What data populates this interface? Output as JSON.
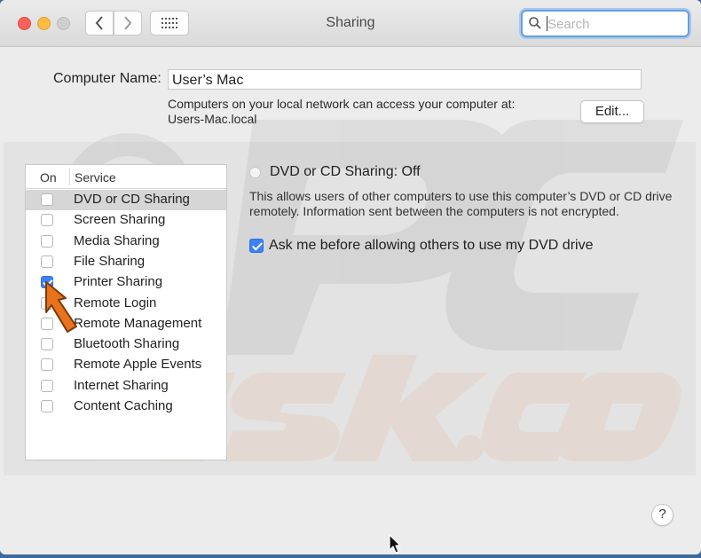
{
  "window": {
    "title": "Sharing",
    "search_placeholder": "Search"
  },
  "computer": {
    "name_label": "Computer Name:",
    "name_value": "User’s Mac",
    "access_line1": "Computers on your local network can access your computer at:",
    "access_line2": "Users-Mac.local",
    "edit_label": "Edit..."
  },
  "services": {
    "header_on": "On",
    "header_service": "Service",
    "items": [
      {
        "label": "DVD or CD Sharing",
        "checked": false,
        "selected": true
      },
      {
        "label": "Screen Sharing",
        "checked": false,
        "selected": false
      },
      {
        "label": "Media Sharing",
        "checked": false,
        "selected": false
      },
      {
        "label": "File Sharing",
        "checked": false,
        "selected": false
      },
      {
        "label": "Printer Sharing",
        "checked": true,
        "selected": false
      },
      {
        "label": "Remote Login",
        "checked": false,
        "selected": false
      },
      {
        "label": "Remote Management",
        "checked": false,
        "selected": false
      },
      {
        "label": "Bluetooth Sharing",
        "checked": false,
        "selected": false
      },
      {
        "label": "Remote Apple Events",
        "checked": false,
        "selected": false
      },
      {
        "label": "Internet Sharing",
        "checked": false,
        "selected": false
      },
      {
        "label": "Content Caching",
        "checked": false,
        "selected": false
      }
    ]
  },
  "detail": {
    "status": "DVD or CD Sharing: Off",
    "description_line1": "This allows users of other computers to use this computer’s DVD or CD drive",
    "description_line2": "remotely. Information sent between the computers is not encrypted.",
    "ask_label": "Ask me before allowing others to use my DVD drive",
    "ask_checked": true
  },
  "help_label": "?",
  "colors": {
    "accent": "#3b82f6",
    "watermark_arrow": "#e8731c"
  }
}
